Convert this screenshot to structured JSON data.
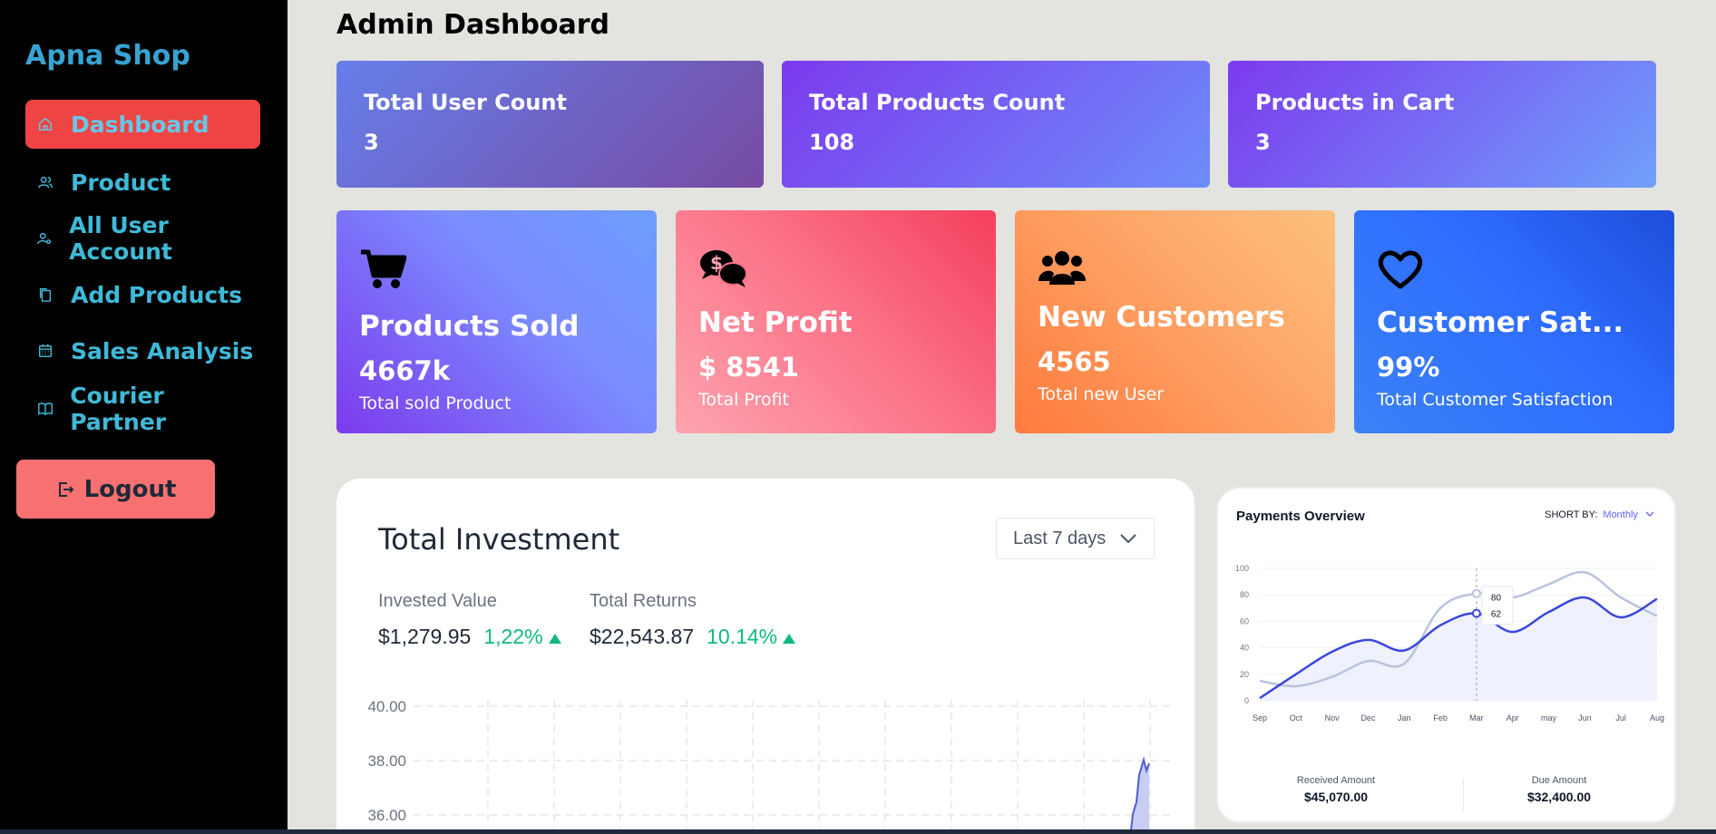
{
  "sidebar": {
    "brand": "Apna Shop",
    "items": [
      {
        "label": "Dashboard",
        "icon": "home-icon",
        "active": true
      },
      {
        "label": "Product",
        "icon": "users-icon"
      },
      {
        "label": "All User Account",
        "icon": "user-settings-icon"
      },
      {
        "label": "Add Products",
        "icon": "copy-icon"
      },
      {
        "label": "Sales Analysis",
        "icon": "calendar-icon"
      },
      {
        "label": "Courier Partner",
        "icon": "book-icon"
      }
    ],
    "logout": "Logout"
  },
  "page": {
    "title": "Admin Dashboard"
  },
  "top_cards": [
    {
      "label": "Total User Count",
      "value": "3"
    },
    {
      "label": "Total Products Count",
      "value": "108"
    },
    {
      "label": "Products in Cart",
      "value": "3"
    }
  ],
  "stat_cards": [
    {
      "label": "Products Sold",
      "value": "4667k",
      "sub": "Total sold Product",
      "icon": "cart-icon"
    },
    {
      "label": "Net Profit",
      "value": "$ 8541",
      "sub": "Total Profit",
      "icon": "money-chat-icon"
    },
    {
      "label": "New Customers",
      "value": "4565",
      "sub": "Total new User",
      "icon": "users-group-icon"
    },
    {
      "label": "Customer Sat...",
      "value": "99%",
      "sub": "Total Customer Satisfaction",
      "icon": "heart-icon"
    }
  ],
  "investment": {
    "title": "Total Investment",
    "range": "Last 7 days",
    "invested_label": "Invested Value",
    "invested_value": "$1,279.95",
    "invested_pct": "1,22%",
    "returns_label": "Total Returns",
    "returns_value": "$22,543.87",
    "returns_pct": "10.14%",
    "y_ticks": [
      "40.00",
      "38.00",
      "36.00"
    ]
  },
  "payments": {
    "title": "Payments Overview",
    "sort_label": "SHORT BY:",
    "sort_value": "Monthly",
    "received_label": "Received Amount",
    "received_value": "$45,070.00",
    "due_label": "Due Amount",
    "due_value": "$32,400.00",
    "tooltip_values": [
      "80",
      "62"
    ]
  },
  "chart_data": [
    {
      "type": "line",
      "categories": [
        "Sep",
        "Oct",
        "Nov",
        "Dec",
        "Jan",
        "Feb",
        "Mar",
        "Apr",
        "may",
        "Jun",
        "Jul",
        "Aug"
      ],
      "ylim": [
        0,
        100
      ],
      "y_ticks": [
        0,
        20,
        40,
        60,
        80,
        100
      ],
      "series": [
        {
          "values": [
            2,
            20,
            37,
            46,
            38,
            57,
            66,
            52,
            67,
            78,
            63,
            77
          ],
          "color": "#3b47d9"
        },
        {
          "values": [
            15,
            11,
            18,
            30,
            28,
            70,
            81,
            78,
            88,
            97,
            78,
            64
          ],
          "color": "#b9c3de"
        }
      ]
    }
  ]
}
